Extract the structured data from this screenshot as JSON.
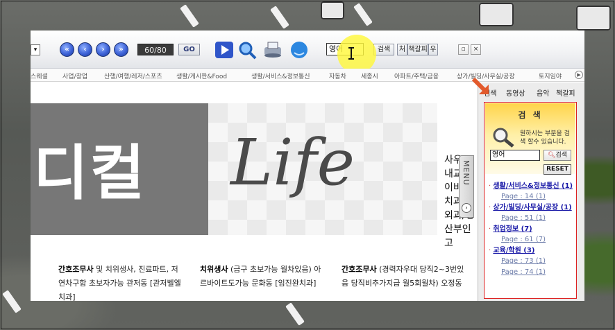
{
  "toolbar": {
    "page_indicator": "60/80",
    "go_label": "GO",
    "search_value": "영어",
    "search_button": "검색",
    "btn_first": "처",
    "btn_book": "책갈피",
    "btn_right": "우"
  },
  "categories": [
    "스웨셜",
    "사업/창업",
    "산행/여행/레저/스포츠",
    "생활/게시판&Food",
    "생활/서비스&정보통신",
    "자동차",
    "세종시",
    "아파트/주택/금융",
    "상가/빌딩/사무실/공장",
    "토지임야"
  ],
  "page": {
    "hero_title": "디컬",
    "hero_life": "Life",
    "side_lines": [
      "사우",
      "내교",
      "이비",
      "치과",
      "외과/정",
      "산부인고"
    ],
    "menu_tab": "MENU",
    "listings": [
      {
        "title": "간호조무사",
        "line1": " 및 치위생사, 진료파트, 저",
        "line2": "연차구함 초보자가능 관저동 [관저벨엘",
        "line3": "치과]"
      },
      {
        "title": "치위생사",
        "line1": " (급구 초보가능 월차있음) 아",
        "line2": "르바이트도가능 문화동 [임진완치과]",
        "line3": ""
      },
      {
        "title": "간호조무사",
        "line1": " (경력자우대 당직2~3번있",
        "line2": "음 당직비추가지급 월5회월차) 오정동",
        "line3": ""
      }
    ]
  },
  "panel": {
    "tabs": [
      "검색",
      "동영상",
      "음악",
      "책갈피"
    ],
    "title": "검 색",
    "hint": "원하시는 부분을 검색 할수 있습니다.",
    "input_value": "영어",
    "search_button": "검색",
    "reset": "RESET",
    "results": [
      {
        "category": "생활/서비스&정보통신 (1)",
        "page": "Page : 14 (1)"
      },
      {
        "category": "상가/빌딩/사무실/공장 (1)",
        "page": "Page : 51 (1)"
      },
      {
        "category": "취업정보 (7)",
        "page": "Page : 61 (7)"
      },
      {
        "category": "교육/학원 (3)",
        "page": "Page : 73 (1)"
      },
      {
        "category": "",
        "page": "Page : 74 (1)"
      }
    ]
  },
  "colors": {
    "accent_orange": "#e25a2c",
    "result_red": "#d22222",
    "link_blue": "#1a1aa8"
  }
}
